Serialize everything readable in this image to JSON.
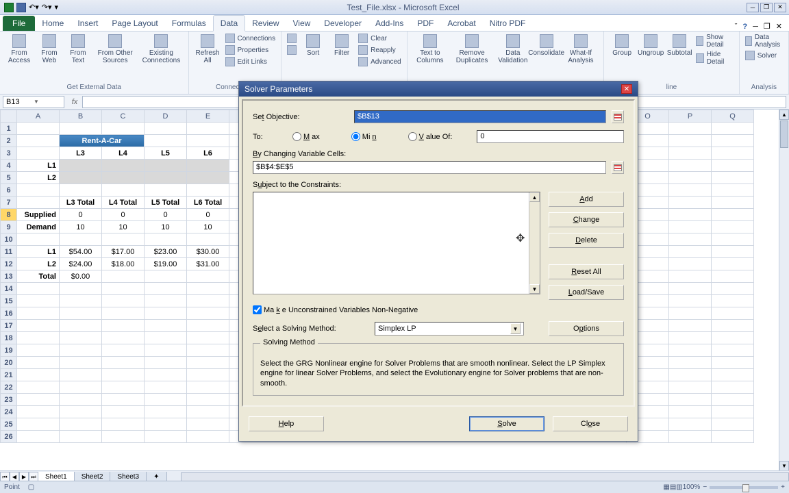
{
  "titlebar": {
    "title": "Test_File.xlsx - Microsoft Excel"
  },
  "tabs": {
    "file": "File",
    "home": "Home",
    "insert": "Insert",
    "page_layout": "Page Layout",
    "formulas": "Formulas",
    "data": "Data",
    "review": "Review",
    "view": "View",
    "developer": "Developer",
    "addins": "Add-Ins",
    "pdf": "PDF",
    "acrobat": "Acrobat",
    "nitro": "Nitro PDF"
  },
  "ribbon": {
    "get_external": {
      "access": "From Access",
      "web": "From Web",
      "text": "From Text",
      "other": "From Other Sources",
      "existing": "Existing Connections",
      "label": "Get External Data"
    },
    "connections": {
      "refresh": "Refresh All",
      "conn": "Connections",
      "prop": "Properties",
      "edit": "Edit Links",
      "label": "Connections"
    },
    "sort_filter": {
      "sort": "Sort",
      "filter": "Filter",
      "clear": "Clear",
      "reapply": "Reapply",
      "advanced": "Advanced"
    },
    "data_tools": {
      "ttc": "Text to Columns",
      "dup": "Remove Duplicates",
      "val": "Data Validation",
      "cons": "Consolidate",
      "whatif": "What-If Analysis"
    },
    "outline": {
      "group": "Group",
      "ungroup": "Ungroup",
      "subtotal": "Subtotal",
      "show": "Show Detail",
      "hide": "Hide Detail",
      "label": "line"
    },
    "analysis": {
      "da": "Data Analysis",
      "solver": "Solver",
      "label": "Analysis"
    }
  },
  "namebox": "B13",
  "columns": [
    "A",
    "B",
    "C",
    "D",
    "E",
    "",
    "",
    "",
    "",
    "",
    "",
    "",
    "",
    "O",
    "P",
    "Q"
  ],
  "spreadsheet": {
    "banner": "Rent-A-Car",
    "col_hdrs": [
      "L3",
      "L4",
      "L5",
      "L6"
    ],
    "row_labels": {
      "l1": "L1",
      "l2": "L2",
      "total": "Total"
    },
    "totals_hdr": [
      "L3 Total",
      "L4 Total",
      "L5 Total",
      "L6 Total"
    ],
    "supplied": {
      "label": "Supplied",
      "vals": [
        "0",
        "0",
        "0",
        "0"
      ]
    },
    "demand": {
      "label": "Demand",
      "vals": [
        "10",
        "10",
        "10",
        "10"
      ]
    },
    "costs": {
      "l1": [
        "$54.00",
        "$17.00",
        "$23.00",
        "$30.00"
      ],
      "l2": [
        "$24.00",
        "$18.00",
        "$19.00",
        "$31.00"
      ]
    },
    "total_val": "$0.00"
  },
  "sheets": [
    "Sheet1",
    "Sheet2",
    "Sheet3"
  ],
  "status": {
    "mode": "Point",
    "zoom": "100%"
  },
  "dialog": {
    "title": "Solver Parameters",
    "set_objective": "Set Objective:",
    "objective_val": "$B$13",
    "to": "To:",
    "max": "Max",
    "min": "Min",
    "value_of": "Value Of:",
    "value_of_val": "0",
    "changing": "By Changing Variable Cells:",
    "changing_val": "$B$4:$E$5",
    "subject": "Subject to the Constraints:",
    "add": "Add",
    "change": "Change",
    "delete": "Delete",
    "reset": "Reset All",
    "loadsave": "Load/Save",
    "options": "Options",
    "nonneg": "Make Unconstrained Variables Non-Negative",
    "select_method": "Select a Solving Method:",
    "method_val": "Simplex LP",
    "method_legend": "Solving Method",
    "method_desc": "Select the GRG Nonlinear engine for Solver Problems that are smooth nonlinear. Select the LP Simplex engine for linear Solver Problems, and select the Evolutionary engine for Solver problems that are non-smooth.",
    "help": "Help",
    "solve": "Solve",
    "close": "Close"
  }
}
